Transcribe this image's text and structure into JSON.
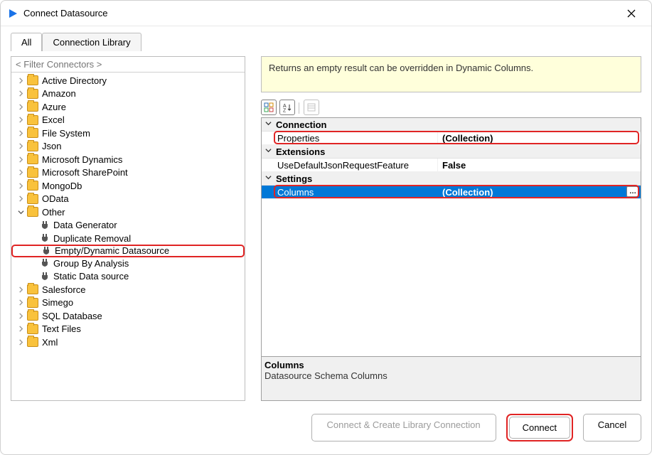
{
  "window": {
    "title": "Connect Datasource"
  },
  "tabs": {
    "all": "All",
    "library": "Connection Library"
  },
  "filter_placeholder": "< Filter Connectors >",
  "tree": [
    {
      "label": "Active Directory",
      "type": "folder",
      "expandable": true
    },
    {
      "label": "Amazon",
      "type": "folder",
      "expandable": true
    },
    {
      "label": "Azure",
      "type": "folder",
      "expandable": true
    },
    {
      "label": "Excel",
      "type": "folder",
      "expandable": true
    },
    {
      "label": "File System",
      "type": "folder",
      "expandable": true
    },
    {
      "label": "Json",
      "type": "folder",
      "expandable": true
    },
    {
      "label": "Microsoft Dynamics",
      "type": "folder",
      "expandable": true
    },
    {
      "label": "Microsoft SharePoint",
      "type": "folder",
      "expandable": true
    },
    {
      "label": "MongoDb",
      "type": "folder",
      "expandable": true
    },
    {
      "label": "OData",
      "type": "folder",
      "expandable": true
    },
    {
      "label": "Other",
      "type": "folder",
      "expandable": true,
      "expanded": true,
      "children": [
        {
          "label": "Data Generator",
          "type": "connector"
        },
        {
          "label": "Duplicate Removal",
          "type": "connector"
        },
        {
          "label": "Empty/Dynamic Datasource",
          "type": "connector",
          "highlighted": true
        },
        {
          "label": "Group By Analysis",
          "type": "connector"
        },
        {
          "label": "Static Data source",
          "type": "connector"
        }
      ]
    },
    {
      "label": "Salesforce",
      "type": "folder",
      "expandable": true
    },
    {
      "label": "Simego",
      "type": "folder",
      "expandable": true
    },
    {
      "label": "SQL Database",
      "type": "folder",
      "expandable": true
    },
    {
      "label": "Text Files",
      "type": "folder",
      "expandable": true
    },
    {
      "label": "Xml",
      "type": "folder",
      "expandable": true
    }
  ],
  "info_text": "Returns an empty result can be overridden in Dynamic Columns.",
  "propgrid": {
    "categories": [
      {
        "name": "Connection",
        "props": [
          {
            "key": "Properties",
            "value": "(Collection)",
            "highlighted": true
          }
        ]
      },
      {
        "name": "Extensions",
        "props": [
          {
            "key": "UseDefaultJsonRequestFeature",
            "value": "False"
          }
        ]
      },
      {
        "name": "Settings",
        "props": [
          {
            "key": "Columns",
            "value": "(Collection)",
            "selected": true,
            "highlighted": true,
            "ellipsis": true
          }
        ]
      }
    ],
    "help": {
      "title": "Columns",
      "desc": "Datasource Schema Columns"
    }
  },
  "footer": {
    "create_lib": "Connect & Create Library Connection",
    "connect": "Connect",
    "cancel": "Cancel"
  }
}
